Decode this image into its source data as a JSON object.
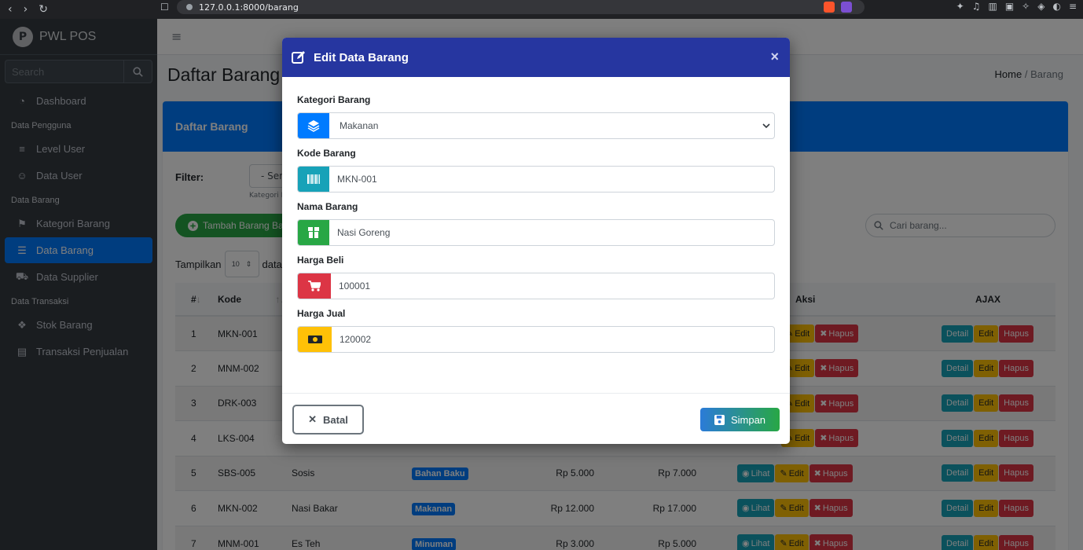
{
  "browser": {
    "url": "127.0.0.1:8000/barang"
  },
  "sidebar": {
    "brand": "PWL POS",
    "search_placeholder": "Search",
    "items": [
      {
        "type": "item",
        "label": "Dashboard",
        "icon": "dashboard-icon"
      },
      {
        "type": "header",
        "label": "Data Pengguna"
      },
      {
        "type": "item",
        "label": "Level User",
        "icon": "layers-icon"
      },
      {
        "type": "item",
        "label": "Data User",
        "icon": "user-icon"
      },
      {
        "type": "header",
        "label": "Data Barang"
      },
      {
        "type": "item",
        "label": "Kategori Barang",
        "icon": "bookmark-icon"
      },
      {
        "type": "item",
        "label": "Data Barang",
        "icon": "list-icon",
        "active": true
      },
      {
        "type": "item",
        "label": "Data Supplier",
        "icon": "truck-icon"
      },
      {
        "type": "header",
        "label": "Data Transaksi"
      },
      {
        "type": "item",
        "label": "Stok Barang",
        "icon": "cubes-icon"
      },
      {
        "type": "item",
        "label": "Transaksi Penjualan",
        "icon": "cash-register-icon"
      }
    ]
  },
  "page": {
    "title": "Daftar Barang",
    "breadcrumb_home": "Home",
    "breadcrumb_sep": "/",
    "breadcrumb_current": "Barang",
    "card_title": "Daftar Barang",
    "filter_label": "Filter:",
    "filter_value": "- Sem",
    "filter_help": "Kategori B",
    "add_button": "Tambah Barang Ba",
    "search_placeholder": "Cari barang...",
    "show_label": "Tampilkan",
    "show_value": "10",
    "show_suffix": "data p"
  },
  "table": {
    "headers": {
      "no": "#",
      "kode": "Kode",
      "aksi": "Aksi",
      "ajax": "AJAX"
    },
    "rows": [
      {
        "no": "1",
        "kode": "MKN-001",
        "nama": "",
        "kategori": "",
        "beli": "",
        "jual": "",
        "show_lihat": false
      },
      {
        "no": "2",
        "kode": "MNM-002",
        "nama": "",
        "kategori": "",
        "beli": "",
        "jual": "",
        "show_lihat": false
      },
      {
        "no": "3",
        "kode": "DRK-003",
        "nama": "",
        "kategori": "",
        "beli": "",
        "jual": "",
        "show_lihat": false
      },
      {
        "no": "4",
        "kode": "LKS-004",
        "nama": "",
        "kategori": "",
        "beli": "",
        "jual": "",
        "show_lihat": false
      },
      {
        "no": "5",
        "kode": "SBS-005",
        "nama": "Sosis",
        "kategori": "Bahan Baku",
        "beli": "Rp 5.000",
        "jual": "Rp 7.000",
        "show_lihat": true
      },
      {
        "no": "6",
        "kode": "MKN-002",
        "nama": "Nasi Bakar",
        "kategori": "Makanan",
        "beli": "Rp 12.000",
        "jual": "Rp 17.000",
        "show_lihat": true
      },
      {
        "no": "7",
        "kode": "MNM-001",
        "nama": "Es Teh",
        "kategori": "Minuman",
        "beli": "Rp 3.000",
        "jual": "Rp 5.000",
        "show_lihat": true
      }
    ],
    "btn_lihat": "Lihat",
    "btn_edit": "Edit",
    "btn_hapus": "Hapus",
    "btn_detail": "Detail"
  },
  "modal": {
    "title": "Edit Data Barang",
    "close": "×",
    "fields": {
      "kategori": {
        "label": "Kategori Barang",
        "value": "Makanan",
        "color": "#007bff"
      },
      "kode": {
        "label": "Kode Barang",
        "value": "MKN-001",
        "color": "#17a2b8"
      },
      "nama": {
        "label": "Nama Barang",
        "value": "Nasi Goreng",
        "color": "#28a745"
      },
      "beli": {
        "label": "Harga Beli",
        "value": "100001",
        "color": "#dc3545"
      },
      "jual": {
        "label": "Harga Jual",
        "value": "120002",
        "color": "#ffc107"
      }
    },
    "cancel": "Batal",
    "save": "Simpan"
  }
}
